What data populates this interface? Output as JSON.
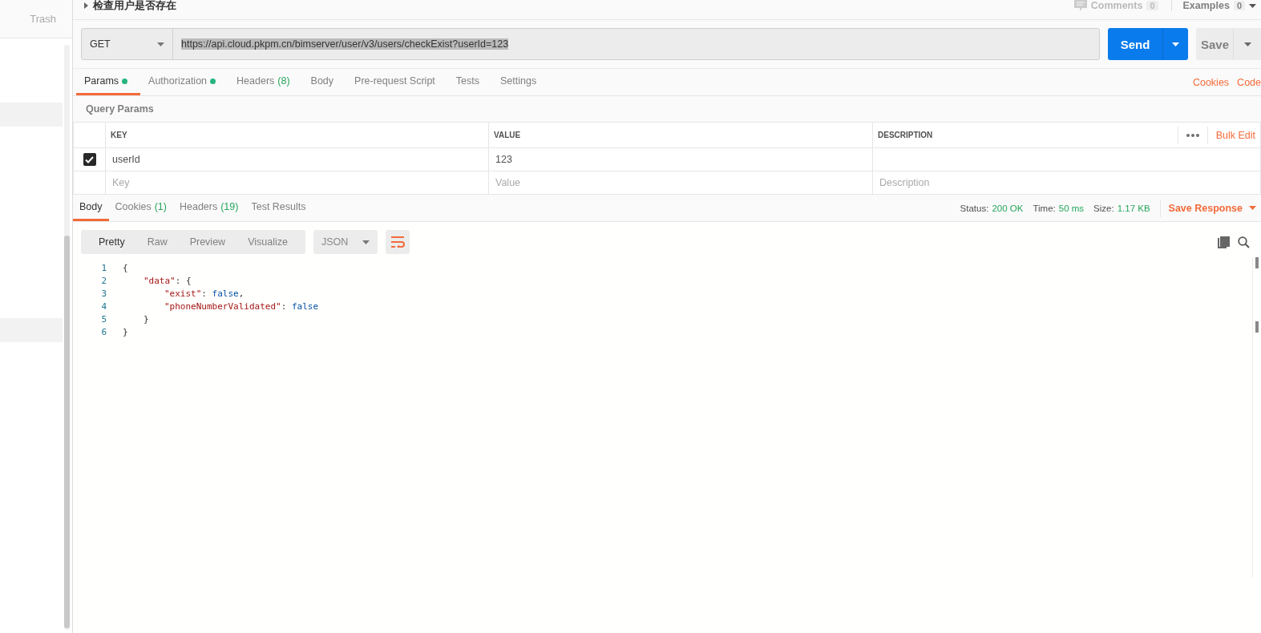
{
  "sidebar": {
    "trash_label": "Trash"
  },
  "request": {
    "title": "检查用户是否存在",
    "comments": {
      "label": "Comments",
      "count": "0"
    },
    "examples": {
      "label": "Examples",
      "count": "0"
    },
    "method": "GET",
    "url": "https://api.cloud.pkpm.cn/bimserver/user/v3/users/checkExist?userId=123",
    "send_label": "Send",
    "save_label": "Save"
  },
  "request_tabs": [
    {
      "label": "Params",
      "dot": true,
      "selected": true
    },
    {
      "label": "Authorization",
      "dot": true,
      "selected": false
    },
    {
      "label": "Headers",
      "count": "(8)",
      "dot": false,
      "selected": false
    },
    {
      "label": "Body",
      "dot": false,
      "selected": false
    },
    {
      "label": "Pre-request Script",
      "dot": false,
      "selected": false
    },
    {
      "label": "Tests",
      "dot": false,
      "selected": false
    },
    {
      "label": "Settings",
      "dot": false,
      "selected": false
    }
  ],
  "request_links": [
    "Cookies",
    "Code"
  ],
  "query_params": {
    "title": "Query Params",
    "columns": [
      "KEY",
      "VALUE",
      "DESCRIPTION"
    ],
    "bulk_edit": "Bulk Edit",
    "rows": [
      {
        "checked": true,
        "key": "userId",
        "value": "123",
        "description": ""
      }
    ],
    "new_row": [
      {
        "placeholder": "Key"
      },
      {
        "placeholder": "Value"
      },
      {
        "placeholder": "Description"
      }
    ]
  },
  "response_tabs": [
    {
      "label": "Body",
      "selected": true
    },
    {
      "label": "Cookies",
      "count": "(1)",
      "selected": false
    },
    {
      "label": "Headers",
      "count": "(19)",
      "selected": false
    },
    {
      "label": "Test Results",
      "selected": false
    }
  ],
  "response_meta": [
    {
      "label": "Status:",
      "value": "200 OK"
    },
    {
      "label": "Time:",
      "value": "50 ms"
    },
    {
      "label": "Size:",
      "value": "1.17 KB"
    }
  ],
  "save_response": "Save Response",
  "view_modes": [
    {
      "label": "Pretty",
      "selected": true
    },
    {
      "label": "Raw",
      "selected": false
    },
    {
      "label": "Preview",
      "selected": false
    },
    {
      "label": "Visualize",
      "selected": false
    }
  ],
  "format": "JSON",
  "code_lines": [
    {
      "number": "1",
      "tokens": [
        {
          "kind": "punct",
          "text": "{"
        }
      ],
      "children": [
        {
          "number": "2",
          "tokens": [
            {
              "kind": "key",
              "text": "\"data\""
            },
            {
              "kind": "punct",
              "text": ": {"
            }
          ],
          "children": [
            {
              "number": "3",
              "tokens": [
                {
                  "kind": "key",
                  "text": "\"exist\""
                },
                {
                  "kind": "punct",
                  "text": ": "
                },
                {
                  "kind": "literal",
                  "text": "false"
                },
                {
                  "kind": "punct",
                  "text": ","
                }
              ]
            },
            {
              "number": "4",
              "tokens": [
                {
                  "kind": "key",
                  "text": "\"phoneNumberValidated\""
                },
                {
                  "kind": "punct",
                  "text": ": "
                },
                {
                  "kind": "literal",
                  "text": "false"
                }
              ]
            }
          ]
        },
        {
          "number": "5",
          "tokens": [
            {
              "kind": "punct",
              "text": "}"
            }
          ]
        }
      ]
    },
    {
      "number": "6",
      "tokens": [
        {
          "kind": "punct",
          "text": "}"
        }
      ]
    }
  ]
}
